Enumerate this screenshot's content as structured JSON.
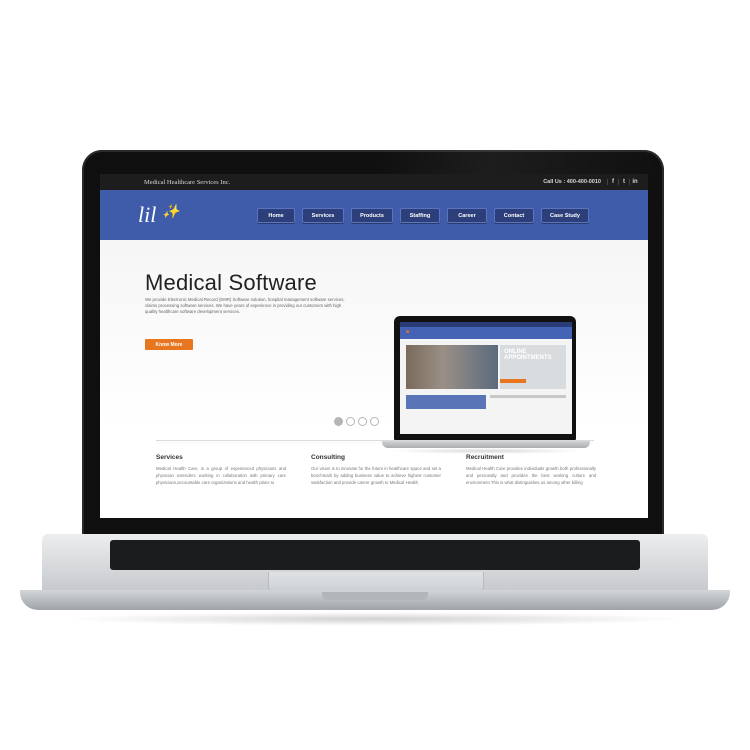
{
  "site": {
    "company": "Medical Healthcare Services Inc.",
    "call": "Call Us : 400-400-0010",
    "social": [
      {
        "icon": "facebook-icon",
        "glyph": "f"
      },
      {
        "icon": "twitter-icon",
        "glyph": "t"
      },
      {
        "icon": "linkedin-icon",
        "glyph": "in"
      }
    ],
    "logo": "lil"
  },
  "nav": {
    "items": [
      "Home",
      "Services",
      "Products",
      "Staffing",
      "Career",
      "Contact",
      "Case Study"
    ]
  },
  "hero": {
    "title": "Medical Software",
    "text": "We provide Electronic Medical Record (EMR) Software solution, hospital management software services, claims processing software services. We have years of experience in providing our customers with high quality healthcare software development services.",
    "button": "Know More",
    "mini_ad": "ONLINE APPOINTMENTS",
    "slides": 4,
    "active_slide": 1
  },
  "columns": [
    {
      "title": "Services",
      "text": "Medical Health Care, is a group of experienced physicians and physician extenders working in collaboration with primary care physicians,accountable care organizations and health plans to"
    },
    {
      "title": "Consulting",
      "text": "Our vision is to innovate for the future in healthcare space and set a benchmark by adding business value to achieve highest customer satisfaction and provide career growth to Medical Health"
    },
    {
      "title": "Recruitment",
      "text": "Medical Health Care provides individuals growth both professionally and personally and provides the best working culture and environment.This is what distinguishes us among other billing"
    }
  ],
  "colors": {
    "nav_blue": "#3f5caa",
    "nav_button": "#2d3f7a",
    "accent_orange": "#e8761f",
    "topbar": "#1d1d1d"
  }
}
